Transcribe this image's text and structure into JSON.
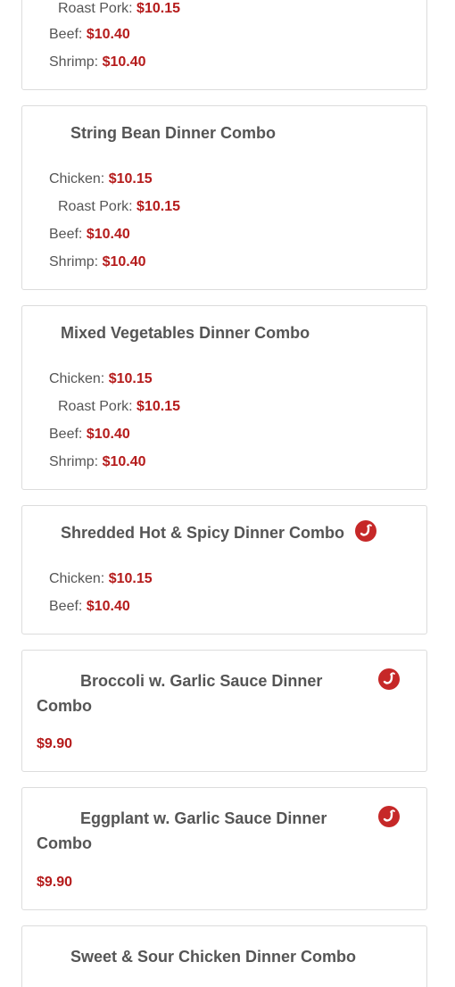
{
  "colors": {
    "price": "#b51b1b",
    "text": "#555555",
    "border": "#dcdcdc",
    "spicy_icon": "#c62828"
  },
  "icons": {
    "spicy": "chili-pepper-icon"
  },
  "cards": [
    {
      "title": "",
      "prices": [
        {
          "label": "Roast Pork:",
          "value": "$10.15"
        },
        {
          "label": "Beef:",
          "value": "$10.40"
        },
        {
          "label": "Shrimp:",
          "value": "$10.40"
        }
      ]
    },
    {
      "title": "String Bean Dinner Combo",
      "prices": [
        {
          "label": "Chicken:",
          "value": "$10.15"
        },
        {
          "label": "Roast Pork:",
          "value": "$10.15"
        },
        {
          "label": "Beef:",
          "value": "$10.40"
        },
        {
          "label": "Shrimp:",
          "value": "$10.40"
        }
      ]
    },
    {
      "title": "Mixed Vegetables Dinner Combo",
      "prices": [
        {
          "label": "Chicken:",
          "value": "$10.15"
        },
        {
          "label": "Roast Pork:",
          "value": "$10.15"
        },
        {
          "label": "Beef:",
          "value": "$10.40"
        },
        {
          "label": "Shrimp:",
          "value": "$10.40"
        }
      ]
    },
    {
      "title": "Shredded Hot & Spicy Dinner Combo",
      "spicy": true,
      "prices": [
        {
          "label": "Chicken:",
          "value": "$10.15"
        },
        {
          "label": "Beef:",
          "value": "$10.40"
        }
      ]
    },
    {
      "title": "Broccoli w. Garlic Sauce Dinner Combo",
      "spicy": true,
      "price": "$9.90"
    },
    {
      "title": "Eggplant w. Garlic Sauce Dinner Combo",
      "spicy": true,
      "price": "$9.90"
    },
    {
      "title": "Sweet & Sour Chicken Dinner Combo"
    }
  ]
}
